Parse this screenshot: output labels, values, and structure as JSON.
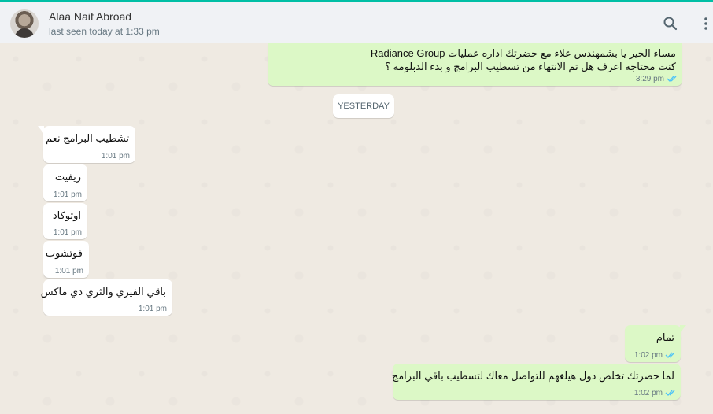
{
  "header": {
    "contact_name": "Alaa Naif Abroad",
    "status": "last seen today at 1:33 pm",
    "search_icon": "search-icon",
    "menu_icon": "more-vertical-icon",
    "accent_color": "#00bfa5"
  },
  "chat": {
    "date_separator": "YESTERDAY",
    "messages": [
      {
        "direction": "outgoing",
        "lines": [
          "مساء الخير يا بشمهندس علاء  مع حضرتك اداره عمليات Radiance Group",
          "كنت محتاجه اعرف هل تم الانتهاء من تسطيب البرامج و بدء الدبلومه   ؟"
        ],
        "time": "3:29 pm",
        "status": "read"
      },
      {
        "direction": "incoming",
        "text": "تشطيب البرامج نعم",
        "time": "1:01 pm"
      },
      {
        "direction": "incoming",
        "text": "ريفيت",
        "time": "1:01 pm"
      },
      {
        "direction": "incoming",
        "text": "اوتوكاد",
        "time": "1:01 pm"
      },
      {
        "direction": "incoming",
        "text": "فوتشوب",
        "time": "1:01 pm"
      },
      {
        "direction": "incoming",
        "text": "باقي الفيري والثري دي ماكس",
        "time": "1:01 pm"
      },
      {
        "direction": "outgoing",
        "text": "تمام",
        "time": "1:02 pm",
        "status": "read"
      },
      {
        "direction": "outgoing",
        "text": "لما حضرتك تخلص دول هيلغهم للتواصل معاك لتسطيب باقي البرامج",
        "time": "1:02 pm",
        "status": "read"
      }
    ]
  },
  "colors": {
    "outgoing_bubble": "#dcf8c6",
    "incoming_bubble": "#ffffff",
    "read_tick": "#4fc3f7"
  }
}
